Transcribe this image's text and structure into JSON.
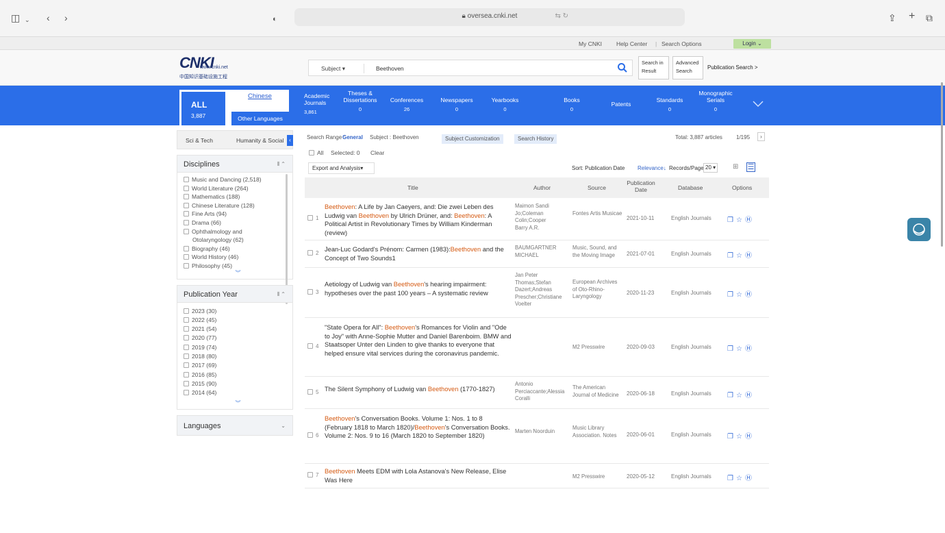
{
  "browser": {
    "url": "oversea.cnki.net"
  },
  "topbar": {
    "my_cnki": "My CNKI",
    "help_center": "Help Center",
    "search_options": "Search Options",
    "login": "Login ⌄"
  },
  "header": {
    "logo_main": "CNKI",
    "logo_url": "www.cnki.net",
    "logo_cn": "中国知识基础设施工程",
    "search_field": "Subject ▾",
    "search_value": "Beethoven",
    "search_in_result": "Search in Result",
    "advanced_search": "Advanced Search",
    "publication_search": "Publication Search >"
  },
  "nav": {
    "all_label": "ALL",
    "all_count": "3,887",
    "chinese": "Chinese",
    "other_languages": "Other Languages",
    "items": [
      {
        "label": "Academic Journals",
        "count": "3,861"
      },
      {
        "label": "Theses & Dissertations",
        "count": "0"
      },
      {
        "label": "Conferences",
        "count": "26"
      },
      {
        "label": "Newspapers",
        "count": "0"
      },
      {
        "label": "Yearbooks",
        "count": "0"
      },
      {
        "label": "Books",
        "count": "0"
      },
      {
        "label": "Patents",
        "count": ""
      },
      {
        "label": "Standards",
        "count": "0"
      },
      {
        "label": "Monographic Serials",
        "count": "0"
      }
    ]
  },
  "sidebar": {
    "tab1": "Sci & Tech",
    "tab2": "Humanity & Social",
    "disciplines_title": "Disciplines",
    "disciplines": [
      "Music and Dancing (2,518)",
      "World Literature (264)",
      "Mathematics (188)",
      "Chinese Literature (128)",
      "Fine Arts (94)",
      "Drama (66)",
      "Ophthalmology and",
      "Otolaryngology (62)",
      "Biography (46)",
      "World History (46)",
      "Philosophy (45)"
    ],
    "pubyear_title": "Publication Year",
    "years": [
      "2023 (30)",
      "2022 (45)",
      "2021 (54)",
      "2020 (77)",
      "2019 (74)",
      "2018 (80)",
      "2017 (69)",
      "2016 (85)",
      "2015 (90)",
      "2014 (64)"
    ],
    "languages_title": "Languages"
  },
  "results": {
    "range_label": "Search Range :",
    "range_value": "General",
    "subject_label": "Subject : Beethoven",
    "subject_customization": "Subject Customization",
    "search_history": "Search History",
    "total": "Total: 3,887 articles",
    "page": "1/195",
    "all": "All",
    "selected": "Selected: 0",
    "clear": "Clear",
    "export": "Export and Analysis▾",
    "sort_label": "Sort: Publication Date",
    "relevance": "Relevance↓",
    "records_label": "Records/Page",
    "records_value": "20 ▾",
    "columns": {
      "title": "Title",
      "author": "Author",
      "source": "Source",
      "date": "Publication Date",
      "database": "Database",
      "options": "Options"
    },
    "rows": [
      {
        "num": "1",
        "title_parts": [
          [
            "hl",
            "Beethoven"
          ],
          [
            "t",
            ": A Life by Jan Caeyers, and: Die zwei Leben des Ludwig van "
          ],
          [
            "hl",
            "Beethoven"
          ],
          [
            "t",
            " by Ulrich Drüner, and: "
          ],
          [
            "hl",
            "Beethoven"
          ],
          [
            "t",
            ": A Political Artist in Revolutionary Times by William Kinderman (review)"
          ]
        ],
        "author": "Maimon Sandi Jo;Coleman Colin;Cooper Barry A.R.",
        "source": "Fontes Artis Musicae",
        "date": "2021-10-11",
        "db": "English Journals"
      },
      {
        "num": "2",
        "title_parts": [
          [
            "t",
            "Jean-Luc Godard's Prénom: Carmen (1983):"
          ],
          [
            "hl",
            "Beethoven"
          ],
          [
            "t",
            " and the Concept of Two Sounds1"
          ]
        ],
        "author": "BAUMGARTNER MICHAEL",
        "source": "Music, Sound, and the Moving Image",
        "date": "2021-07-01",
        "db": "English Journals"
      },
      {
        "num": "3",
        "title_parts": [
          [
            "t",
            "Aetiology of Ludwig van "
          ],
          [
            "hl",
            "Beethoven"
          ],
          [
            "t",
            "'s hearing impairment: hypotheses over the past 100 years – A systematic review"
          ]
        ],
        "author": "Jan Peter Thomas;Stefan Dazert;Andreas Prescher;Christiane Voelter",
        "source": "European Archives of Oto-Rhino-Laryngology",
        "date": "2020-11-23",
        "db": "English Journals"
      },
      {
        "num": "4",
        "title_parts": [
          [
            "t",
            "\"State Opera for All\": "
          ],
          [
            "hl",
            "Beethoven"
          ],
          [
            "t",
            "'s Romances for Violin and \"Ode to Joy\" with Anne-Sophie Mutter and Daniel Barenboim. BMW and Staatsoper Unter den Linden to give thanks to everyone that helped ensure vital services during the coronavirus pandemic."
          ]
        ],
        "author": "",
        "source": "M2 Presswire",
        "date": "2020-09-03",
        "db": "English Journals"
      },
      {
        "num": "5",
        "title_parts": [
          [
            "t",
            "The Silent Symphony of Ludwig van "
          ],
          [
            "hl",
            "Beethoven"
          ],
          [
            "t",
            " (1770-1827)"
          ]
        ],
        "author": "Antonio Perciaccante;Alessia Coralli",
        "source": "The American Journal of Medicine",
        "date": "2020-06-18",
        "db": "English Journals"
      },
      {
        "num": "6",
        "title_parts": [
          [
            "hl",
            "Beethoven"
          ],
          [
            "t",
            "'s Conversation Books. Volume 1: Nos. 1 to 8 (February 1818 to March 1820)/"
          ],
          [
            "hl",
            "Beethoven"
          ],
          [
            "t",
            "'s Conversation Books. Volume 2: Nos. 9 to 16 (March 1820 to September 1820)"
          ]
        ],
        "author": "Marten Noorduin",
        "source": "Music Library Association. Notes",
        "date": "2020-06-01",
        "db": "English Journals"
      },
      {
        "num": "7",
        "title_parts": [
          [
            "hl",
            "Beethoven"
          ],
          [
            "t",
            " Meets EDM with Lola Astanova's New Release, Elise Was Here"
          ]
        ],
        "author": "",
        "source": "M2 Presswire",
        "date": "2020-05-12",
        "db": "English Journals"
      }
    ]
  },
  "colors": {
    "nav_blue": "#2b6ee8",
    "highlight": "#d55a12",
    "login_green": "#bde0a0"
  }
}
